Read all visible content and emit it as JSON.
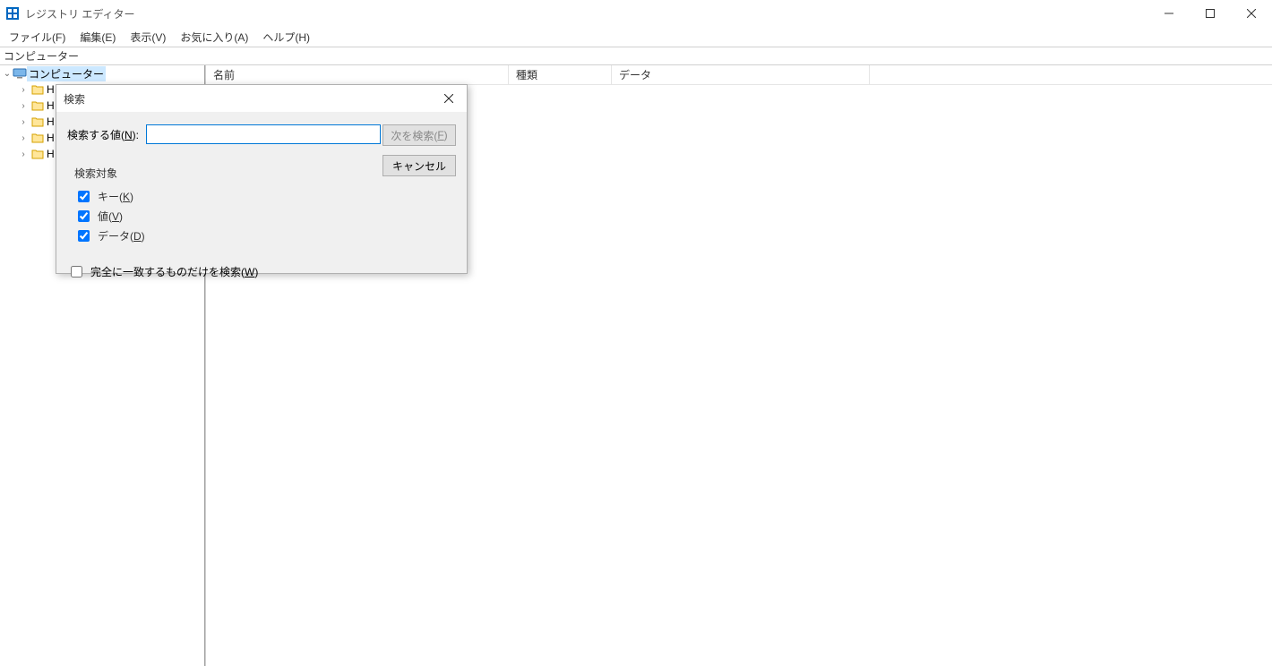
{
  "window": {
    "title": "レジストリ エディター",
    "address": "コンピューター"
  },
  "menu": {
    "file": "ファイル(F)",
    "edit": "編集(E)",
    "view": "表示(V)",
    "fav": "お気に入り(A)",
    "help": "ヘルプ(H)"
  },
  "tree": {
    "root": "コンピューター",
    "items": [
      "H",
      "H",
      "H",
      "H",
      "H"
    ]
  },
  "columns": {
    "name": "名前",
    "type": "種類",
    "data": "データ"
  },
  "dialog": {
    "title": "検索",
    "search_label_pre": "検索する値(",
    "search_label_u": "N",
    "search_label_post": "):",
    "input_value": "",
    "find_next_pre": "次を検索(",
    "find_next_u": "F",
    "find_next_post": ")",
    "cancel": "キャンセル",
    "group_title": "検索対象",
    "chk_keys_pre": "キー(",
    "chk_keys_u": "K",
    "chk_keys_post": ")",
    "chk_values_pre": "値(",
    "chk_values_u": "V",
    "chk_values_post": ")",
    "chk_data_pre": "データ(",
    "chk_data_u": "D",
    "chk_data_post": ")",
    "chk_whole_pre": "完全に一致するものだけを検索(",
    "chk_whole_u": "W",
    "chk_whole_post": ")",
    "chk_keys_checked": true,
    "chk_values_checked": true,
    "chk_data_checked": true,
    "chk_whole_checked": false
  }
}
